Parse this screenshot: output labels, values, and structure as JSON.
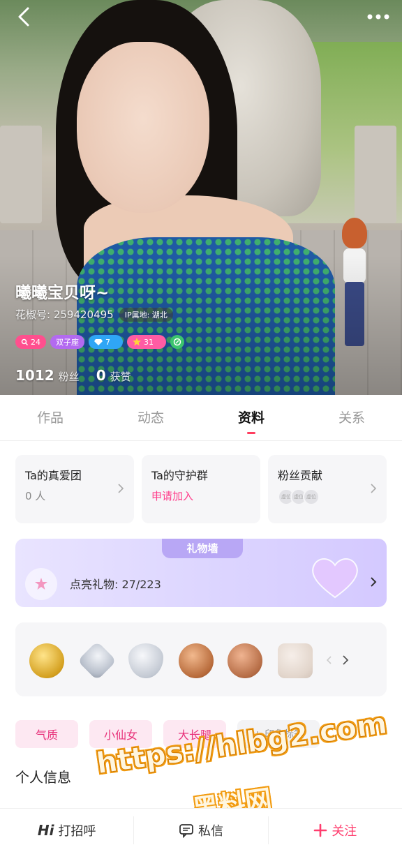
{
  "profile": {
    "name": "曦曦宝贝呀~",
    "id_text": "花椒号: 259420495",
    "ip_location": "IP属地: 湖北",
    "badges": {
      "level": "24",
      "zodiac": "双子座",
      "diamond": "7",
      "star": "31"
    },
    "fans_count": "1012",
    "fans_label": "粉丝",
    "likes_count": "0",
    "likes_label": "获赞"
  },
  "tabs": [
    {
      "label": "作品"
    },
    {
      "label": "动态"
    },
    {
      "label": "资料"
    },
    {
      "label": "关系"
    }
  ],
  "active_tab": "资料",
  "cards": {
    "fan_club": {
      "title": "Ta的真爱团",
      "value": "0 人"
    },
    "guard_group": {
      "title": "Ta的守护群",
      "action": "申请加入"
    },
    "fan_contribution": {
      "title": "粉丝贡献",
      "slots": [
        "虚位",
        "虚位",
        "虚位"
      ]
    }
  },
  "gift_wall": {
    "label": "礼物墙",
    "text": "点亮礼物: 27/223"
  },
  "tags": [
    "气质",
    "小仙女",
    "大长腿"
  ],
  "add_tag_label": "+ 印象标签",
  "section_title": "个人信息",
  "bottom_bar": {
    "greet": "打招呼",
    "greet_prefix": "Hi",
    "message": "私信",
    "follow": "关注"
  },
  "watermark": {
    "url": "https://hlbg2.com",
    "text": "黑料网"
  },
  "colors": {
    "accent_pink": "#ff3d8b",
    "tab_indicator": "#ff3e5f",
    "gift_wall_bg": "#ddd6ff"
  }
}
